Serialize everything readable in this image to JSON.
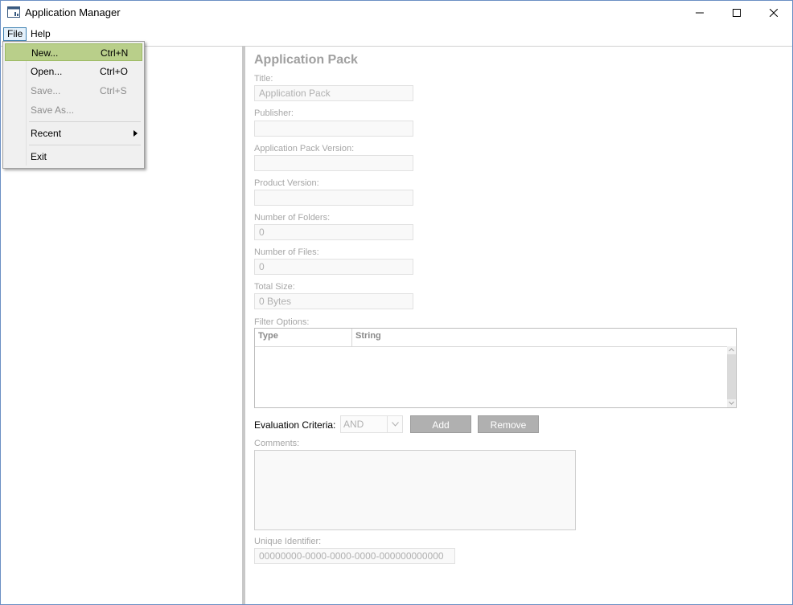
{
  "window": {
    "title": "Application Manager",
    "icon": "application-icon"
  },
  "menubar": {
    "file": "File",
    "help": "Help"
  },
  "file_menu": {
    "items": [
      {
        "label": "New...",
        "shortcut": "Ctrl+N",
        "enabled": true,
        "selected": true
      },
      {
        "label": "Open...",
        "shortcut": "Ctrl+O",
        "enabled": true
      },
      {
        "label": "Save...",
        "shortcut": "Ctrl+S",
        "enabled": false
      },
      {
        "label": "Save As...",
        "shortcut": "",
        "enabled": false
      },
      {
        "label": "Recent",
        "shortcut": "",
        "enabled": true,
        "submenu": true
      },
      {
        "label": "Exit",
        "shortcut": "",
        "enabled": true
      }
    ]
  },
  "form": {
    "title": "Application Pack",
    "title_label": "Title:",
    "title_value": "Application Pack",
    "publisher_label": "Publisher:",
    "publisher_value": "",
    "pack_version_label": "Application Pack Version:",
    "pack_version_value": "",
    "product_version_label": "Product Version:",
    "product_version_value": "",
    "folders_label": "Number of Folders:",
    "folders_value": "0",
    "files_label": "Number of Files:",
    "files_value": "0",
    "size_label": "Total Size:",
    "size_value": "0 Bytes",
    "filter_label": "Filter Options:",
    "filter_columns": [
      "Type",
      "String"
    ],
    "eval_label": "Evaluation Criteria:",
    "eval_value": "AND",
    "add_button": "Add",
    "remove_button": "Remove",
    "comments_label": "Comments:",
    "comments_value": "",
    "uid_label": "Unique Identifier:",
    "uid_value": "00000000-0000-0000-0000-000000000000"
  },
  "colors": {
    "menu_highlight": "#b9cf8a",
    "button_disabled": "#b0b0b0",
    "window_border": "#6b8fc4"
  }
}
